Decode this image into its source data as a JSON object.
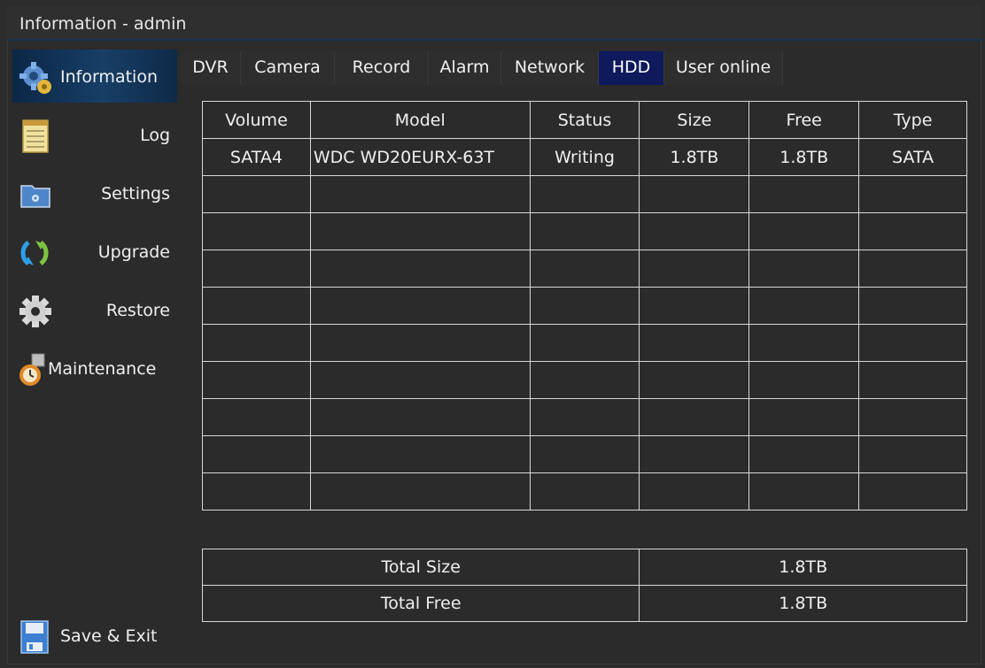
{
  "window": {
    "title": "Information - admin"
  },
  "sidebar": {
    "items": [
      {
        "label": "Information",
        "icon": "gear-info-icon"
      },
      {
        "label": "Log",
        "icon": "notepad-icon"
      },
      {
        "label": "Settings",
        "icon": "folder-gear-icon"
      },
      {
        "label": "Upgrade",
        "icon": "refresh-arrows-icon"
      },
      {
        "label": "Restore",
        "icon": "gear-icon"
      },
      {
        "label": "Maintenance",
        "icon": "clock-tool-icon"
      }
    ],
    "save_exit": {
      "label": "Save & Exit",
      "icon": "floppy-disk-icon"
    }
  },
  "tabs": [
    "DVR",
    "Camera",
    "Record",
    "Alarm",
    "Network",
    "HDD",
    "User online"
  ],
  "active_tab": "HDD",
  "hdd_table": {
    "columns": [
      "Volume",
      "Model",
      "Status",
      "Size",
      "Free",
      "Type"
    ],
    "rows": [
      [
        "SATA4",
        "WDC WD20EURX-63T",
        "Writing",
        "1.8TB",
        "1.8TB",
        "SATA"
      ]
    ]
  },
  "summary": {
    "total_size_label": "Total Size",
    "total_size_value": "1.8TB",
    "total_free_label": "Total Free",
    "total_free_value": "1.8TB"
  }
}
